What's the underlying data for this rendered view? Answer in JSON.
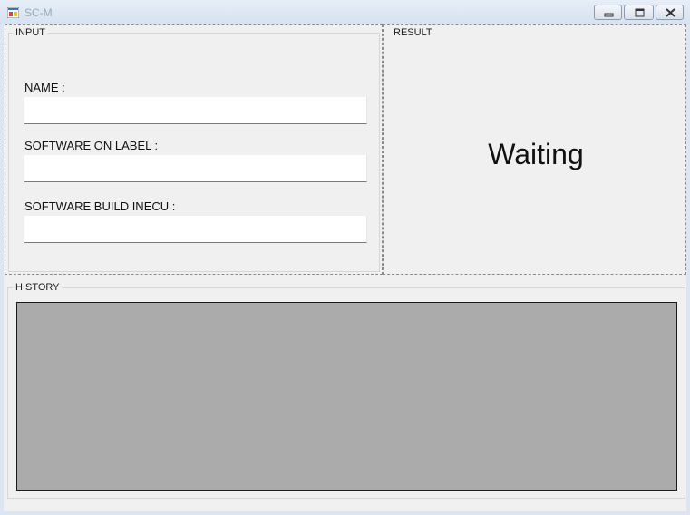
{
  "window": {
    "title": "SC-M",
    "icon": "app-window-icon",
    "controls": [
      "minimize-icon",
      "maximize-icon",
      "close-icon"
    ]
  },
  "input_group": {
    "legend": "INPUT",
    "fields": [
      {
        "label": "NAME :",
        "value": ""
      },
      {
        "label": "SOFTWARE ON LABEL :",
        "value": ""
      },
      {
        "label": "SOFTWARE BUILD INECU :",
        "value": ""
      }
    ]
  },
  "result_group": {
    "legend": "RESULT",
    "status": "Waiting"
  },
  "history_group": {
    "legend": "HISTORY",
    "entries": []
  },
  "colors": {
    "client_background": "#f0f0f0",
    "history_background": "#ababab"
  }
}
